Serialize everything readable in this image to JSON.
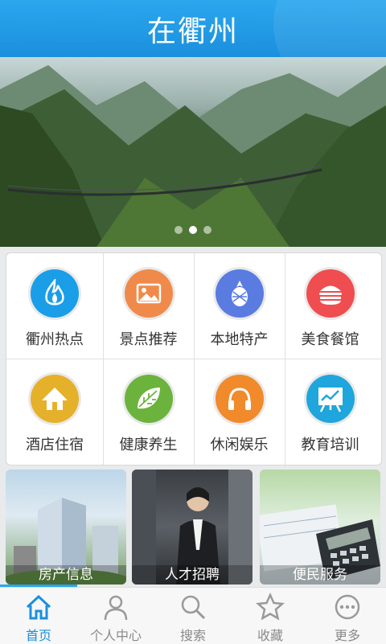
{
  "header": {
    "title": "在衢州"
  },
  "banner": {
    "slide_count": 3,
    "active_slide": 2
  },
  "categories": [
    {
      "label": "衢州热点",
      "icon": "flame-icon",
      "color": "#1a9ee8"
    },
    {
      "label": "景点推荐",
      "icon": "picture-icon",
      "color": "#f08a4a"
    },
    {
      "label": "本地特产",
      "icon": "pineapple-icon",
      "color": "#5a7ce0"
    },
    {
      "label": "美食餐馆",
      "icon": "burger-icon",
      "color": "#ef4d4f"
    },
    {
      "label": "酒店住宿",
      "icon": "house-icon",
      "color": "#e6b12a"
    },
    {
      "label": "健康养生",
      "icon": "leaf-icon",
      "color": "#6bb33d"
    },
    {
      "label": "休闲娱乐",
      "icon": "headphones-icon",
      "color": "#f08a2a"
    },
    {
      "label": "教育培训",
      "icon": "chart-board-icon",
      "color": "#1fa6dc"
    }
  ],
  "cards": [
    {
      "label": "房产信息"
    },
    {
      "label": "人才招聘"
    },
    {
      "label": "便民服务"
    }
  ],
  "tabs": [
    {
      "label": "首页",
      "icon": "home-icon"
    },
    {
      "label": "个人中心",
      "icon": "user-icon"
    },
    {
      "label": "搜索",
      "icon": "search-icon"
    },
    {
      "label": "收藏",
      "icon": "star-icon"
    },
    {
      "label": "更多",
      "icon": "more-icon"
    }
  ],
  "active_tab": 0
}
